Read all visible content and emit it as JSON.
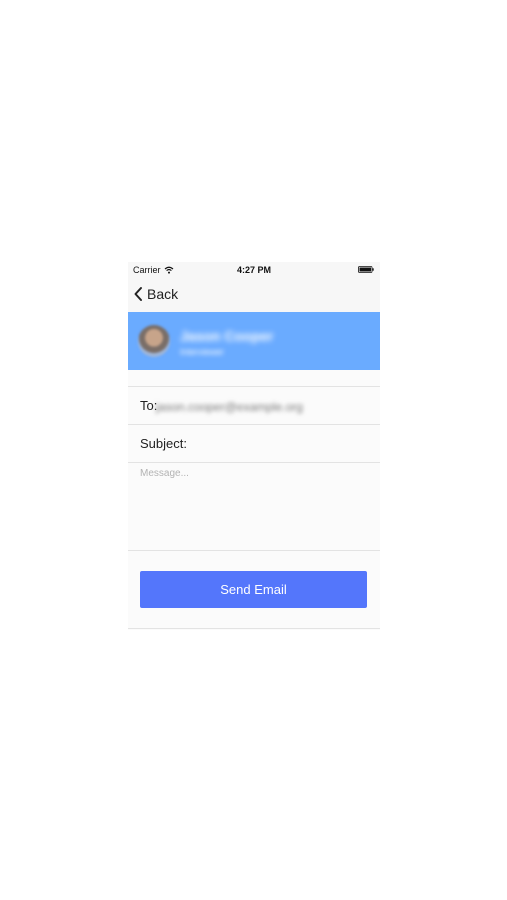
{
  "status_bar": {
    "carrier": "Carrier",
    "time": "4:27 PM"
  },
  "nav": {
    "back_label": "Back"
  },
  "profile": {
    "name": "Jason Cooper",
    "subtitle": "Interviewer"
  },
  "form": {
    "to_label": "To:",
    "to_value": "jason.cooper@example.org",
    "subject_label": "Subject:",
    "message_placeholder": "Message..."
  },
  "actions": {
    "send_label": "Send Email"
  },
  "colors": {
    "banner": "#6aabff",
    "send_button": "#5476fb"
  }
}
